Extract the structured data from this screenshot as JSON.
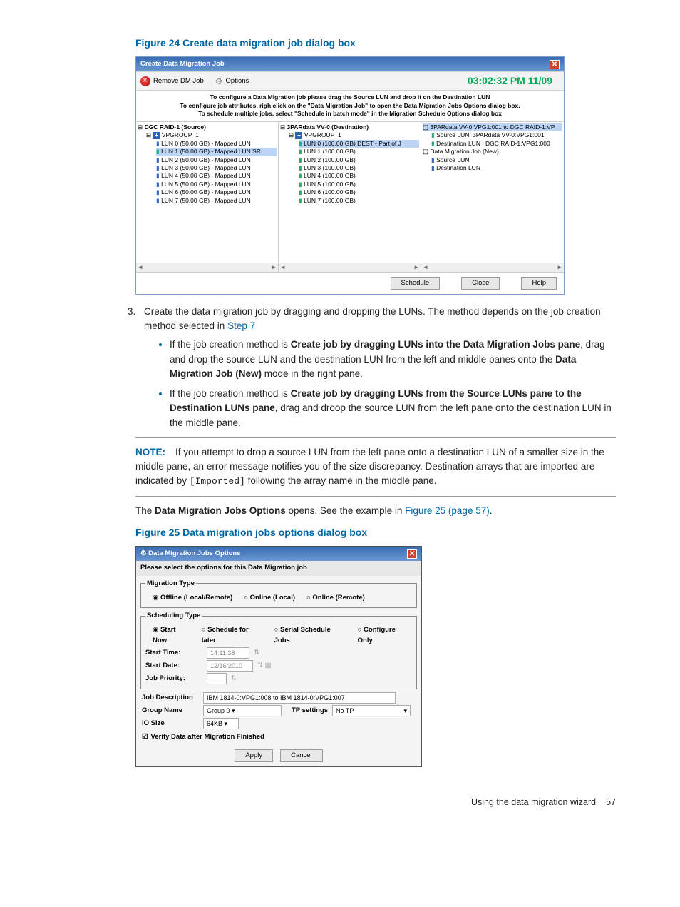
{
  "fig24": {
    "caption": "Figure 24 Create data migration job dialog box",
    "dialog": {
      "title": "Create Data Migration Job",
      "toolbar": {
        "remove": "Remove DM Job",
        "options": "Options",
        "clock": "03:02:32 PM 11/09"
      },
      "hint1": "To configure a Data Migration job please drag the Source LUN and drop it on the Destination LUN",
      "hint2": "To configure job attributes, righ click on the \"Data Migration Job\" to open the Data Migration Jobs Options dialog box.",
      "hint3": "To schedule multiple jobs, select \"Schedule in batch mode\" in the Migration Schedule Options dialog box",
      "left": {
        "root": "DGC RAID-1 (Source)",
        "grp": "VPGROUP_1",
        "items": [
          "LUN 0 (50.00 GB) - Mapped LUN",
          "LUN 1 (50.00 GB) - Mapped LUN SR",
          "LUN 2 (50.00 GB) - Mapped LUN",
          "LUN 3 (50.00 GB) - Mapped LUN",
          "LUN 4 (50.00 GB) - Mapped LUN",
          "LUN 5 (50.00 GB) - Mapped LUN",
          "LUN 6 (50.00 GB) - Mapped LUN",
          "LUN 7 (50.00 GB) - Mapped LUN"
        ]
      },
      "mid": {
        "root": "3PARdata VV-0 (Destination)",
        "grp": "VPGROUP_1",
        "items": [
          "LUN 0 (100.00 GB) DEST - Part of J",
          "LUN 1 (100.00 GB)",
          "LUN 2 (100.00 GB)",
          "LUN 3 (100.00 GB)",
          "LUN 4 (100.00 GB)",
          "LUN 5 (100.00 GB)",
          "LUN 6 (100.00 GB)",
          "LUN 7 (100.00 GB)"
        ]
      },
      "right": {
        "top": "3PARdata VV-0:VPG1:001 to DGC RAID-1:VP",
        "srcLun": "Source LUN: 3PARdata VV-0:VPG1:001",
        "dstLun": "Destination LUN : DGC RAID-1:VPG1:000",
        "jobNew": "Data Migration Job (New)",
        "src": "Source LUN",
        "dst": "Destination LUN"
      },
      "buttons": {
        "schedule": "Schedule",
        "close": "Close",
        "help": "Help"
      }
    }
  },
  "body": {
    "step3": "Create the data migration job by dragging and dropping the LUNs. The method depends on the job creation method selected in ",
    "step7link": "Step 7",
    "bullet1a": "If the job creation method is ",
    "bullet1b": "Create job by dragging LUNs into the Data Migration Jobs pane",
    "bullet1c": ", drag and drop the source LUN and the destination LUN from the left and middle panes onto the ",
    "bullet1d": "Data Migration Job (New)",
    "bullet1e": " mode in the right pane.",
    "bullet2a": "If the job creation method is ",
    "bullet2b": "Create job by dragging LUNs from the Source LUNs pane to the Destination LUNs pane",
    "bullet2c": ", drag and droop the source LUN from the left pane onto the destination LUN in the middle pane.",
    "noteLabel": "NOTE:",
    "noteBody1": "If you attempt to drop a source LUN from the left pane onto a destination LUN of a smaller size in the middle pane, an error message notifies you of the size discrepancy. Destination arrays that are imported are indicated by ",
    "noteMono": "[Imported]",
    "noteBody2": " following the array name in the middle pane.",
    "openLine1": "The ",
    "openLine2": "Data Migration Jobs Options",
    "openLine3": " opens. See the example in ",
    "figlink": "Figure 25 (page 57)",
    "openLine4": "."
  },
  "fig25": {
    "caption": "Figure 25 Data migration jobs options dialog box",
    "dialog": {
      "title": "Data Migration Jobs Options",
      "sub": "Please select the options for this Data Migration job",
      "migration": {
        "legend": "Migration Type",
        "opt1": "Offline (Local/Remote)",
        "opt2": "Online (Local)",
        "opt3": "Online (Remote)"
      },
      "scheduling": {
        "legend": "Scheduling Type",
        "r": {
          "now": "Start Now",
          "later": "Schedule for later",
          "serial": "Serial Schedule Jobs",
          "conf": "Configure Only"
        },
        "startTimeLbl": "Start Time:",
        "startTimeVal": "14:11:38",
        "startDateLbl": "Start Date:",
        "startDateVal": "12/16/2010",
        "jobPrioLbl": "Job Priority:"
      },
      "desc": {
        "lbl": "Job Description",
        "val": "IBM 1814-0:VPG1:008 to IBM 1814-0:VPG1:007"
      },
      "group": {
        "lbl": "Group Name",
        "val": "Group 0"
      },
      "tp": {
        "lbl": "TP settings",
        "val": "No TP"
      },
      "io": {
        "lbl": "IO Size",
        "val": "64KB"
      },
      "verify": "Verify Data after Migration Finished",
      "buttons": {
        "apply": "Apply",
        "cancel": "Cancel"
      }
    }
  },
  "footer": {
    "text": "Using the data migration wizard",
    "page": "57"
  }
}
